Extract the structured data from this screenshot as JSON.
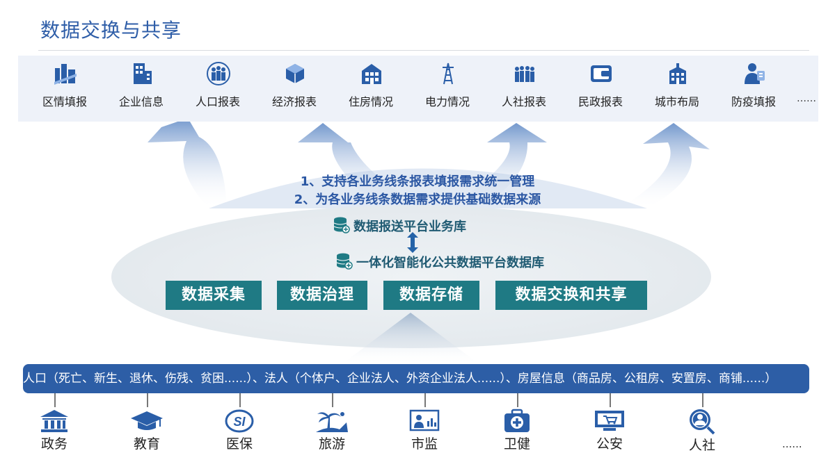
{
  "title": "数据交换与共享",
  "categories": [
    {
      "label": "区情填报",
      "icon": "district-report-icon"
    },
    {
      "label": "企业信息",
      "icon": "enterprise-icon"
    },
    {
      "label": "人口报表",
      "icon": "population-icon"
    },
    {
      "label": "经济报表",
      "icon": "economy-icon"
    },
    {
      "label": "住房情况",
      "icon": "housing-icon"
    },
    {
      "label": "电力情况",
      "icon": "power-tower-icon"
    },
    {
      "label": "人社报表",
      "icon": "social-security-icon"
    },
    {
      "label": "民政报表",
      "icon": "civil-affairs-icon"
    },
    {
      "label": "城市布局",
      "icon": "city-layout-icon"
    },
    {
      "label": "防疫填报",
      "icon": "epidemic-report-icon"
    }
  ],
  "categories_more": "……",
  "messages": {
    "line1": "1、支持各业务线条报表填报需求统一管理",
    "line2": "2、为各业务线条数据需求提供基础数据来源"
  },
  "databases": {
    "upper": "数据报送平台业务库",
    "lower": "一体化智能化公共数据平台数据库"
  },
  "functions": [
    "数据采集",
    "数据治理",
    "数据存储",
    "数据交换和共享"
  ],
  "sources_text": "人口（死亡、新生、退休、伤残、贫困......）、法人（个体户、企业法人、外资企业法人......）、房屋信息（商品房、公租房、安置房、商铺......）",
  "departments": [
    {
      "label": "政务",
      "icon": "government-building-icon"
    },
    {
      "label": "教育",
      "icon": "graduation-cap-icon"
    },
    {
      "label": "医保",
      "icon": "medical-insurance-icon"
    },
    {
      "label": "旅游",
      "icon": "palm-tree-icon"
    },
    {
      "label": "市监",
      "icon": "market-supervision-icon"
    },
    {
      "label": "卫健",
      "icon": "medical-kit-icon"
    },
    {
      "label": "公安",
      "icon": "public-security-icon"
    },
    {
      "label": "人社",
      "icon": "person-search-icon"
    }
  ],
  "departments_more": "......",
  "colors": {
    "title": "#2f5ea8",
    "accent_box": "#1f7a84",
    "source_bar": "#2d5ea6",
    "icon_blue": "#2a5ea8"
  }
}
